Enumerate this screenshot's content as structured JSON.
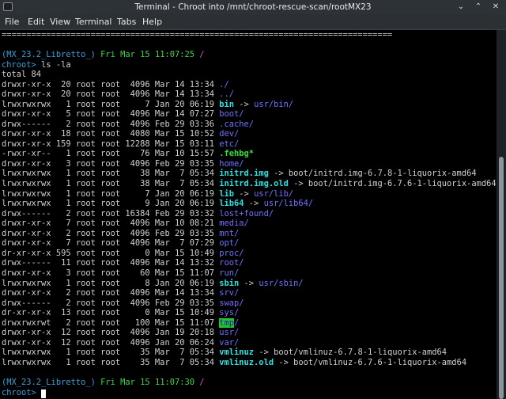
{
  "window": {
    "title": "Terminal - Chroot into /mnt/chroot-rescue-scan/rootMX23",
    "icon": "terminal-icon",
    "controls": [
      "minimize-icon",
      "maximize-icon",
      "close-icon"
    ]
  },
  "menu": [
    "File",
    "Edit",
    "View",
    "Terminal",
    "Tabs",
    "Help"
  ],
  "terminal": {
    "separator": "===============================================================================",
    "prompt_header_1": {
      "host": "(MX_23.2_Libretto_)",
      "date": "Fri Mar 15 11:07:25",
      "slash": "/"
    },
    "prompt_1": {
      "label": "chroot>",
      "command": " ls -la"
    },
    "total": "total 84",
    "listing": [
      {
        "meta": "drwxr-xr-x  20 root root  4096 Mar 14 13:34 ",
        "name": "./",
        "style": "dir",
        "target": ""
      },
      {
        "meta": "drwxr-xr-x  20 root root  4096 Mar 14 13:34 ",
        "name": "../",
        "style": "dir",
        "target": ""
      },
      {
        "meta": "lrwxrwxrwx   1 root root     7 Jan 20 06:19 ",
        "name": "bin",
        "style": "link",
        "target": "usr/bin/"
      },
      {
        "meta": "drwxr-xr-x   5 root root  4096 Mar 14 07:27 ",
        "name": "boot/",
        "style": "dir",
        "target": ""
      },
      {
        "meta": "drwx------   2 root root  4096 Feb 29 03:36 ",
        "name": ".cache/",
        "style": "dir",
        "target": ""
      },
      {
        "meta": "drwxr-xr-x  18 root root  4080 Mar 15 10:52 ",
        "name": "dev/",
        "style": "dir",
        "target": ""
      },
      {
        "meta": "drwxr-xr-x 159 root root 12288 Mar 15 03:11 ",
        "name": "etc/",
        "style": "dir",
        "target": ""
      },
      {
        "meta": "-rwxr-xr--   1 root root    76 Mar 10 15:57 ",
        "name": ".fehbg*",
        "style": "exec",
        "target": ""
      },
      {
        "meta": "drwxr-xr-x   3 root root  4096 Feb 29 03:35 ",
        "name": "home/",
        "style": "dir",
        "target": ""
      },
      {
        "meta": "lrwxrwxrwx   1 root root    38 Mar  7 05:34 ",
        "name": "initrd.img",
        "style": "link",
        "target": "boot/initrd.img-6.7.8-1-liquorix-amd64"
      },
      {
        "meta": "lrwxrwxrwx   1 root root    38 Mar  7 05:34 ",
        "name": "initrd.img.old",
        "style": "link",
        "target": "boot/initrd.img-6.7.6-1-liquorix-amd64"
      },
      {
        "meta": "lrwxrwxrwx   1 root root     7 Jan 20 06:19 ",
        "name": "lib",
        "style": "link",
        "target": "usr/lib/"
      },
      {
        "meta": "lrwxrwxrwx   1 root root     9 Jan 20 06:19 ",
        "name": "lib64",
        "style": "link",
        "target": "usr/lib64/"
      },
      {
        "meta": "drwx------   2 root root 16384 Feb 29 03:32 ",
        "name": "lost+found/",
        "style": "dir",
        "target": ""
      },
      {
        "meta": "drwxr-xr-x   7 root root  4096 Mar 10 08:21 ",
        "name": "media/",
        "style": "dir",
        "target": ""
      },
      {
        "meta": "drwxr-xr-x   2 root root  4096 Feb 29 03:35 ",
        "name": "mnt/",
        "style": "dir",
        "target": ""
      },
      {
        "meta": "drwxr-xr-x   7 root root  4096 Mar  7 07:29 ",
        "name": "opt/",
        "style": "dir",
        "target": ""
      },
      {
        "meta": "dr-xr-xr-x 595 root root     0 Mar 15 10:49 ",
        "name": "proc/",
        "style": "dir",
        "target": ""
      },
      {
        "meta": "drwx------  11 root root  4096 Mar 14 13:32 ",
        "name": "root/",
        "style": "dir",
        "target": ""
      },
      {
        "meta": "drwxr-xr-x   3 root root    60 Mar 15 11:07 ",
        "name": "run/",
        "style": "dir",
        "target": ""
      },
      {
        "meta": "lrwxrwxrwx   1 root root     8 Jan 20 06:19 ",
        "name": "sbin",
        "style": "link",
        "target": "usr/sbin/"
      },
      {
        "meta": "drwxr-xr-x   2 root root  4096 Mar 14 13:34 ",
        "name": "srv/",
        "style": "dir",
        "target": ""
      },
      {
        "meta": "drwx------   2 root root  4096 Feb 29 03:35 ",
        "name": "swap/",
        "style": "dir",
        "target": ""
      },
      {
        "meta": "dr-xr-xr-x  13 root root     0 Mar 15 10:49 ",
        "name": "sys/",
        "style": "dir",
        "target": ""
      },
      {
        "meta": "drwxrwxrwt   2 root root   100 Mar 15 11:07 ",
        "name": "tmp",
        "suffix": "/",
        "style": "sticky",
        "target": ""
      },
      {
        "meta": "drwxr-xr-x  12 root root  4096 Jan 19 20:18 ",
        "name": "usr/",
        "style": "dir",
        "target": ""
      },
      {
        "meta": "drwxr-xr-x  12 root root  4096 Jan 20 06:24 ",
        "name": "var/",
        "style": "dir",
        "target": ""
      },
      {
        "meta": "lrwxrwxrwx   1 root root    35 Mar  7 05:34 ",
        "name": "vmlinuz",
        "style": "link",
        "target": "boot/vmlinuz-6.7.8-1-liquorix-amd64"
      },
      {
        "meta": "lrwxrwxrwx   1 root root    35 Mar  7 05:34 ",
        "name": "vmlinuz.old",
        "style": "link",
        "target": "boot/vmlinuz-6.7.6-1-liquorix-amd64"
      }
    ],
    "prompt_header_2": {
      "host": "(MX_23.2_Libretto_)",
      "date": "Fri Mar 15 11:07:30",
      "slash": "/"
    },
    "prompt_2": {
      "label": "chroot>"
    },
    "arrow": " -> ",
    "colors": {
      "directory": "#6f72ff",
      "symlink": "#2fe0e0",
      "executable": "#36e03a",
      "sticky_bg": "#26c42e",
      "sticky_fg": "#1a1aa8",
      "prompt": "#3a9ed8",
      "date": "#3fd34a",
      "slash": "#d54fd5"
    }
  }
}
